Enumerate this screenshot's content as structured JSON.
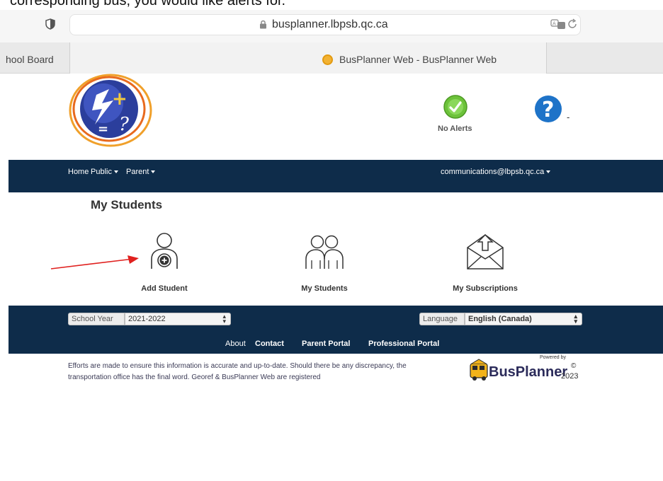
{
  "caption": "corresponding bus, you would like alerts for.",
  "browser": {
    "url": "busplanner.lbpsb.qc.ca",
    "tabs": [
      {
        "label": "hool Board"
      },
      {
        "label": "BusPlanner Web - BusPlanner Web"
      }
    ]
  },
  "header": {
    "alerts_label": "No Alerts",
    "help_suffix": "-"
  },
  "nav": {
    "home": "Home",
    "public": "Public",
    "parent": "Parent",
    "account": "communications@lbpsb.qc.ca"
  },
  "main": {
    "title": "My Students",
    "actions": [
      {
        "label": "Add Student",
        "icon": "add-student-icon"
      },
      {
        "label": "My Students",
        "icon": "students-icon"
      },
      {
        "label": "My Subscriptions",
        "icon": "subscriptions-envelope-icon"
      }
    ]
  },
  "footer": {
    "school_year_label": "School Year",
    "school_year_value": "2021-2022",
    "language_label": "Language",
    "language_value": "English (Canada)",
    "links": [
      {
        "label": "About"
      },
      {
        "label": "Contact"
      },
      {
        "label": "Parent Portal"
      },
      {
        "label": "Professional Portal"
      }
    ],
    "disclaimer": "Efforts are made to ensure this information is accurate and up-to-date. Should there be any discrepancy, the transportation office has the final word. Georef & BusPlanner Web are registered",
    "brand": "BusPlanner",
    "powered_by": "Powered by",
    "copyright_sign": "©",
    "year": "2023"
  },
  "colors": {
    "navbar": "#0e2c4a",
    "annotation_arrow": "#e0201e",
    "help_blue": "#1e73c8",
    "alert_green": "#6cc23a"
  }
}
